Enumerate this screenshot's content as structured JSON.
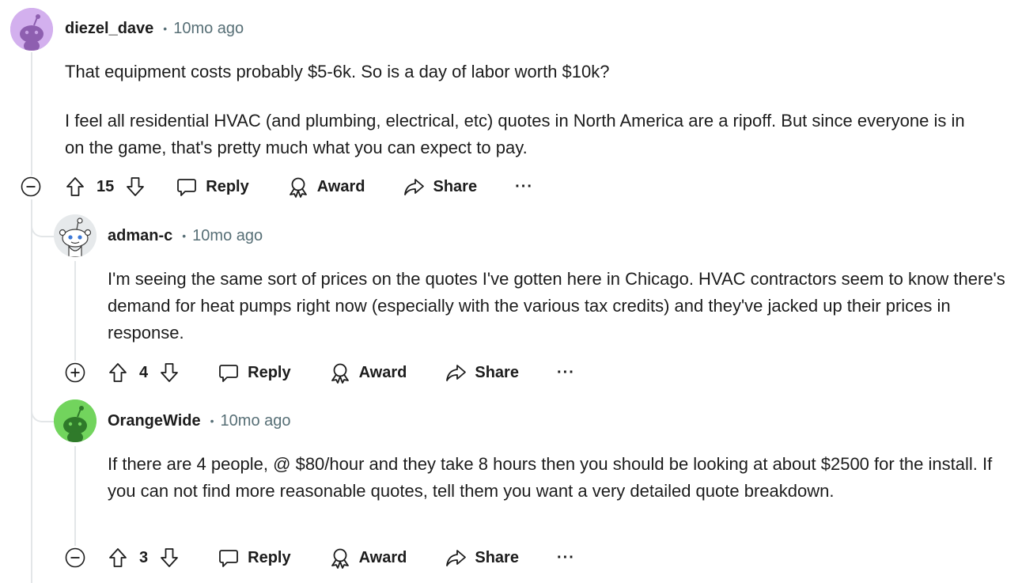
{
  "comments": [
    {
      "author": "diezel_dave",
      "time": "10mo ago",
      "paragraphs": [
        "That equipment costs probably $5-6k. So is a day of labor worth $10k?",
        "I feel all residential HVAC (and plumbing, electrical, etc) quotes in North America are a ripoff. But since everyone is in on the game, that's pretty much what you can expect to pay."
      ],
      "votes": "15",
      "toggle": "collapse",
      "avatar_color": "#c9a3e6"
    },
    {
      "author": "adman-c",
      "time": "10mo ago",
      "paragraphs": [
        "I'm seeing the same sort of prices on the quotes I've gotten here in Chicago. HVAC contractors seem to know there's demand for heat pumps right now (especially with the various tax credits) and they've jacked up their prices in response."
      ],
      "votes": "4",
      "toggle": "expand",
      "avatar_color": "#e9ecee"
    },
    {
      "author": "OrangeWide",
      "time": "10mo ago",
      "paragraphs": [
        "If there are 4 people, @ $80/hour and they take 8 hours then you should be looking at about $2500 for the install. If you can not find more reasonable quotes, tell them you want a very detailed quote breakdown."
      ],
      "votes": "3",
      "toggle": "collapse",
      "avatar_color": "#6fd35a"
    }
  ],
  "actions": {
    "reply": "Reply",
    "award": "Award",
    "share": "Share",
    "more": "···"
  },
  "icons": {
    "upvote": "upvote-icon",
    "downvote": "downvote-icon",
    "reply": "comment-bubble-icon",
    "award": "award-ribbon-icon",
    "share": "share-arrow-icon",
    "collapse": "minus-circle-icon",
    "expand": "plus-circle-icon"
  }
}
